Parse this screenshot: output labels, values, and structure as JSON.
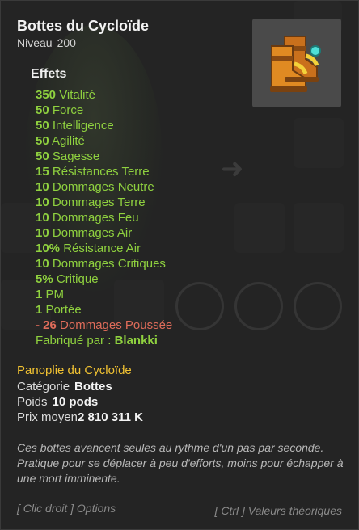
{
  "item": {
    "name": "Bottes du Cycloïde",
    "level_label": "Niveau",
    "level_value": "200",
    "image_icon": "boots-icon"
  },
  "effects": {
    "title": "Effets",
    "lines": [
      {
        "num": "350",
        "text": "Vitalité"
      },
      {
        "num": "50",
        "text": "Force"
      },
      {
        "num": "50",
        "text": "Intelligence"
      },
      {
        "num": "50",
        "text": "Agilité"
      },
      {
        "num": "50",
        "text": "Sagesse"
      },
      {
        "num": "15",
        "text": "Résistances Terre"
      },
      {
        "num": "10",
        "text": "Dommages Neutre"
      },
      {
        "num": "10",
        "text": "Dommages Terre"
      },
      {
        "num": "10",
        "text": "Dommages Feu"
      },
      {
        "num": "10",
        "text": "Dommages Air"
      },
      {
        "num": "10%",
        "text": "Résistance Air"
      },
      {
        "num": "10",
        "text": "Dommages Critiques"
      },
      {
        "num": "5%",
        "text": "Critique"
      },
      {
        "num": "1",
        "text": "PM"
      },
      {
        "num": "1",
        "text": "Portée"
      }
    ],
    "negative": {
      "num": "- 26",
      "text": "Dommages Poussée"
    },
    "crafted": {
      "label": "Fabriqué par :",
      "crafter": "Blankki"
    }
  },
  "set": {
    "name": "Panoplie du Cycloïde"
  },
  "info": {
    "category_label": "Catégorie",
    "category_value": "Bottes",
    "weight_label": "Poids",
    "weight_value": "10 pods",
    "price_label": "Prix moyen",
    "price_value": "2 810 311 K"
  },
  "description": "Ces bottes avancent seules au rythme d'un pas par seconde. Pratique pour se déplacer à peu d'efforts, moins pour échapper à une mort imminente.",
  "footer": {
    "right_click": "[ Clic droit ] Options",
    "ctrl": "[ Ctrl ] Valeurs théoriques"
  },
  "colors": {
    "bonus": "#8fd13f",
    "malus": "#e06c5a",
    "set": "#f1c232"
  }
}
